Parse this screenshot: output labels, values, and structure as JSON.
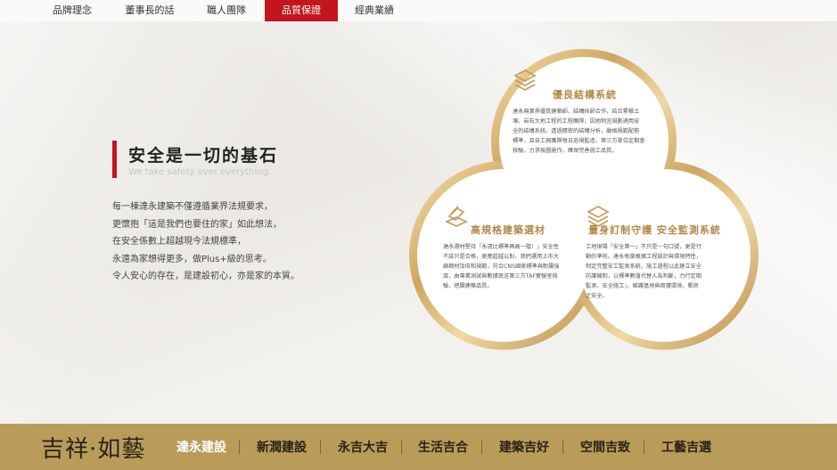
{
  "nav": {
    "items": [
      {
        "label": "品牌理念"
      },
      {
        "label": "董事長的話"
      },
      {
        "label": "職人團隊"
      },
      {
        "label": "品質保證",
        "active": true
      },
      {
        "label": "經典業績"
      }
    ]
  },
  "section": {
    "title": "安全是一切的基石",
    "subtitle": "We take safety over everything.",
    "paragraph": [
      "每一棟達永建築不僅遵循業界法規要求，",
      "更懷抱「這是我們也要住的家」如此想法，",
      "在安全係數上超越現今法規標準，",
      "永遠為家想得更多，做Plus+級的思考。",
      "令人安心的存在，是建設初心，亦是家的本質。"
    ]
  },
  "features": [
    {
      "icon": "cube-layers-icon",
      "title": "優良結構系統",
      "lines": [
        "達永與業界優質建築師、結構技師合作，結合累積土",
        "壤、岩石大地工程的工程團隊，因地制宜規劃適用安",
        "全的結構系統。透過精密的結構分析，嚴格規範配筋",
        "標準，且自工務團隊每日巡視監造，第三方單位定期查",
        "核驗，力求按圖施作，確保完善施工品質。"
      ]
    },
    {
      "icon": "materials-stack-icon",
      "title": "高規格建築選材",
      "lines": [
        "達永選材堅持「永遠比標準再高一階！」安全性",
        "不該只是合格，更應超越以對，我們選用上市大",
        "廠鋼材加倍和規範，符合CNS國家標準與耐震強",
        "度，由專業測試與數據丟送第三方TAF實驗室檢",
        "驗，把關建築品質。"
      ]
    },
    {
      "icon": "layered-shield-icon",
      "title": "量身訂制守護 安全監測系統",
      "lines": [
        "工地現場「安全第一」不只是一句口號，更是行",
        "動的準則。達永每案根據工程設計與環境特性，",
        "制定完整安工監測系統，施工過程以此建立安全",
        "防護機制，以標準數值代替人為判斷，力行定期",
        "監測、安全施工」，維護基地與周遭環境，鄰房",
        "之安全。"
      ]
    }
  ],
  "footer": {
    "logo": "吉祥·如藝",
    "links": [
      {
        "label": "達永建設",
        "active": true
      },
      {
        "label": "新潤建設"
      },
      {
        "label": "永吉大吉"
      },
      {
        "label": "生活吉合"
      },
      {
        "label": "建築吉好"
      },
      {
        "label": "空間吉致"
      },
      {
        "label": "工藝吉選"
      }
    ]
  },
  "colors": {
    "accent": "#c2161c",
    "gold": "#b3894a",
    "footer_bg": "#b99b5a"
  }
}
